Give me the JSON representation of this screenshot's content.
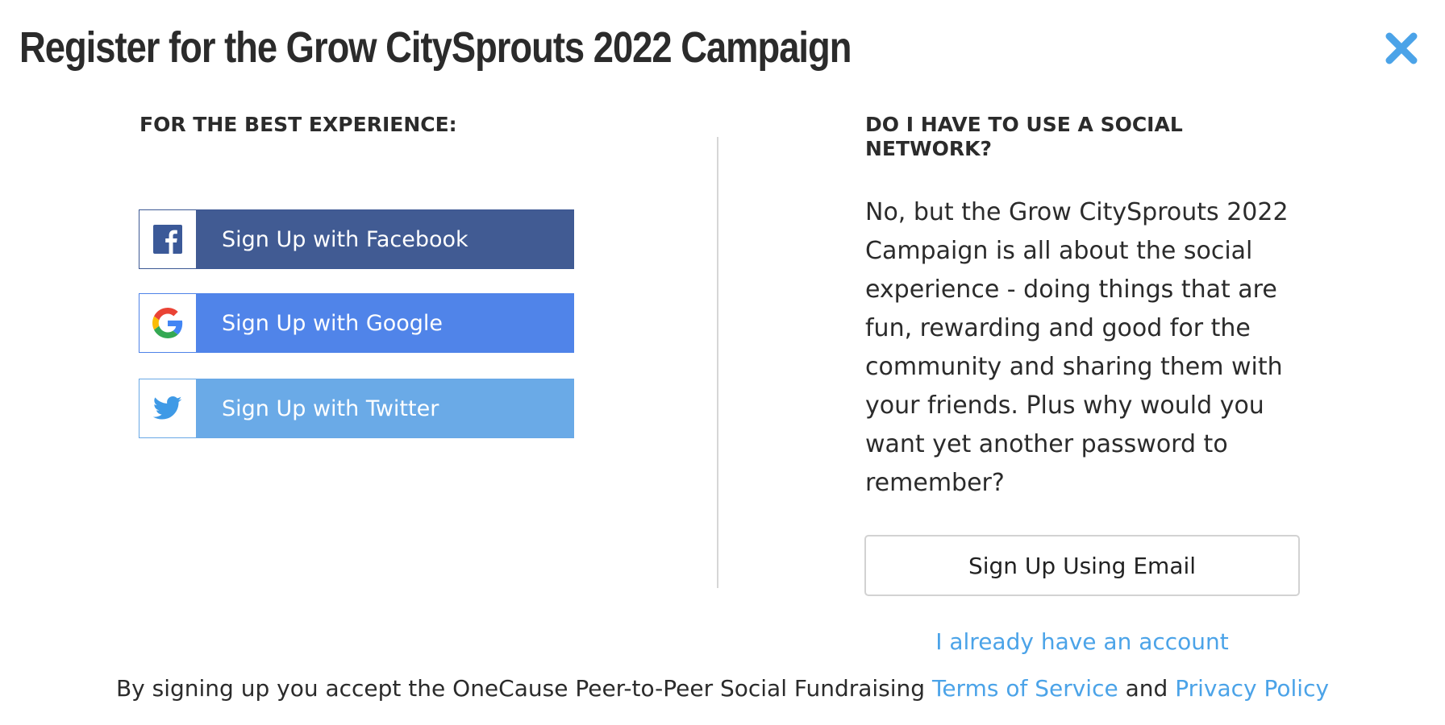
{
  "modal": {
    "title": "Register for the Grow CitySprouts 2022 Campaign",
    "close_icon": "close-icon"
  },
  "left": {
    "heading": "FOR THE BEST EXPERIENCE:",
    "buttons": [
      {
        "label": "Sign Up with Facebook",
        "icon": "facebook-icon",
        "color": "#415b93"
      },
      {
        "label": "Sign Up with Google",
        "icon": "google-icon",
        "color": "#5084e9"
      },
      {
        "label": "Sign Up with Twitter",
        "icon": "twitter-icon",
        "color": "#6aaae7"
      }
    ]
  },
  "right": {
    "heading": "DO I HAVE TO USE A SOCIAL NETWORK?",
    "body": "No, but the Grow CitySprouts 2022 Campaign is all about the social experience - doing things that are fun, rewarding and good for the community and sharing them with your friends. Plus why would you want yet another password to remember?",
    "email_button": "Sign Up Using Email",
    "already_link": "I already have an account"
  },
  "footer": {
    "prefix": "By signing up you accept the OneCause Peer-to-Peer Social Fundraising",
    "terms_link": "Terms of Service",
    "and": "and",
    "privacy_link": "Privacy Policy"
  },
  "colors": {
    "accent": "#4ba3e8",
    "facebook": "#415b93",
    "google": "#5084e9",
    "twitter": "#6aaae7"
  }
}
